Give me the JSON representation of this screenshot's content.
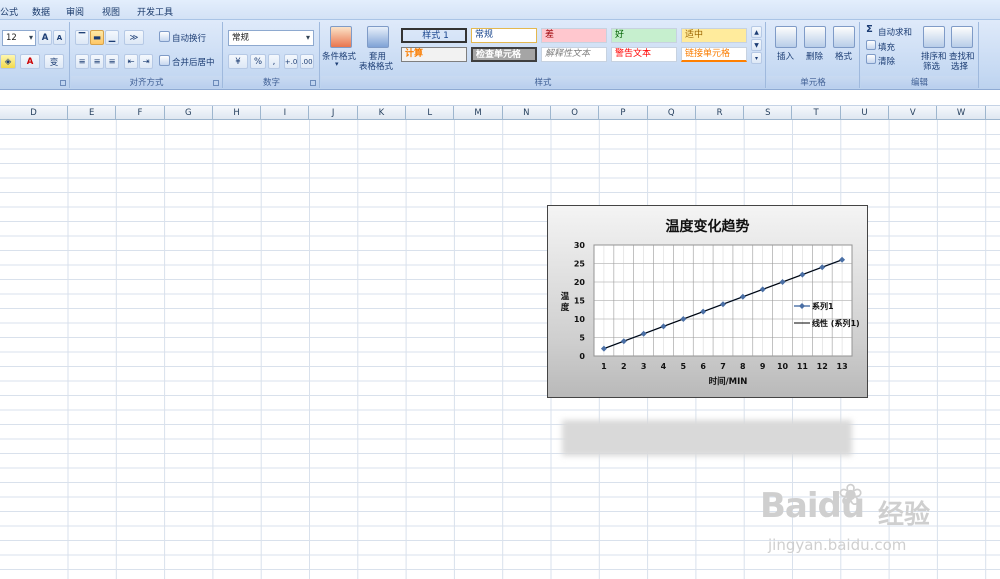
{
  "menu": {
    "items": [
      "公式",
      "数据",
      "审阅",
      "视图",
      "开发工具"
    ]
  },
  "ribbon": {
    "font": {
      "size_value": "12",
      "grow_label": "A",
      "shrink_label": "A",
      "font_color_label": "A",
      "phonetic_label": "变"
    },
    "alignment": {
      "wrap_label": "自动换行",
      "merge_label": "合并后居中",
      "group_label": "对齐方式"
    },
    "number": {
      "format_value": "常规",
      "percent_label": "%",
      "comma_label": ",",
      "inc_label": "+.0",
      "dec_label": ".00",
      "group_label": "数字"
    },
    "styles": {
      "cond_format_label": "条件格式",
      "table_format_label_1": "套用",
      "table_format_label_2": "表格格式",
      "cells": [
        {
          "label": "样式 1",
          "bg": "#ffffff",
          "color": "#000000"
        },
        {
          "label": "常规",
          "bg": "#ffffff",
          "color": "#000000"
        },
        {
          "label": "差",
          "bg": "#ffc7ce",
          "color": "#9c0006"
        },
        {
          "label": "好",
          "bg": "#c6efce",
          "color": "#006100"
        },
        {
          "label": "适中",
          "bg": "#ffeb9c",
          "color": "#9c6500"
        },
        {
          "label": "计算",
          "bg": "#f2f2f2",
          "color": "#fa7d00"
        },
        {
          "label": "检查单元格",
          "bg": "#a5a5a5",
          "color": "#ffffff"
        },
        {
          "label": "解释性文本",
          "bg": "#ffffff",
          "color": "#7f7f7f"
        },
        {
          "label": "警告文本",
          "bg": "#ffffff",
          "color": "#ff0000"
        },
        {
          "label": "链接单元格",
          "bg": "#ffffff",
          "color": "#fa7d00"
        }
      ],
      "group_label": "样式"
    },
    "cells": {
      "insert_label": "插入",
      "delete_label": "删除",
      "format_label": "格式",
      "group_label": "单元格"
    },
    "editing": {
      "autosum_label": "自动求和",
      "fill_label": "填充",
      "clear_label": "清除",
      "sort_label_1": "排序和",
      "sort_label_2": "筛选",
      "find_label_1": "查找和",
      "find_label_2": "选择",
      "group_label": "编辑"
    }
  },
  "sheet": {
    "columns": [
      "D",
      "E",
      "F",
      "G",
      "H",
      "I",
      "J",
      "K",
      "L",
      "M",
      "N",
      "O",
      "P",
      "Q",
      "R",
      "S",
      "T",
      "U",
      "V",
      "W"
    ]
  },
  "chart_data": {
    "type": "line",
    "title": "温度变化趋势",
    "xlabel": "时间/MIN",
    "ylabel": "温度",
    "categories": [
      1,
      2,
      3,
      4,
      5,
      6,
      7,
      8,
      9,
      10,
      11,
      12,
      13
    ],
    "series": [
      {
        "name": "系列1",
        "values": [
          2,
          4,
          6,
          8,
          10,
          12,
          14,
          16,
          18,
          20,
          22,
          24,
          26
        ],
        "color": "#4a6fa5"
      },
      {
        "name": "线性 (系列1)",
        "values": [
          2,
          4,
          6,
          8,
          10,
          12,
          14,
          16,
          18,
          20,
          22,
          24,
          26
        ],
        "color": "#000000"
      }
    ],
    "ylim": [
      0,
      30
    ],
    "yticks": [
      0,
      5,
      10,
      15,
      20,
      25,
      30
    ],
    "grid": true,
    "legend": "right"
  },
  "watermark": {
    "brand": "Baidu",
    "brand_cn": "经验",
    "url": "jingyan.baidu.com"
  }
}
